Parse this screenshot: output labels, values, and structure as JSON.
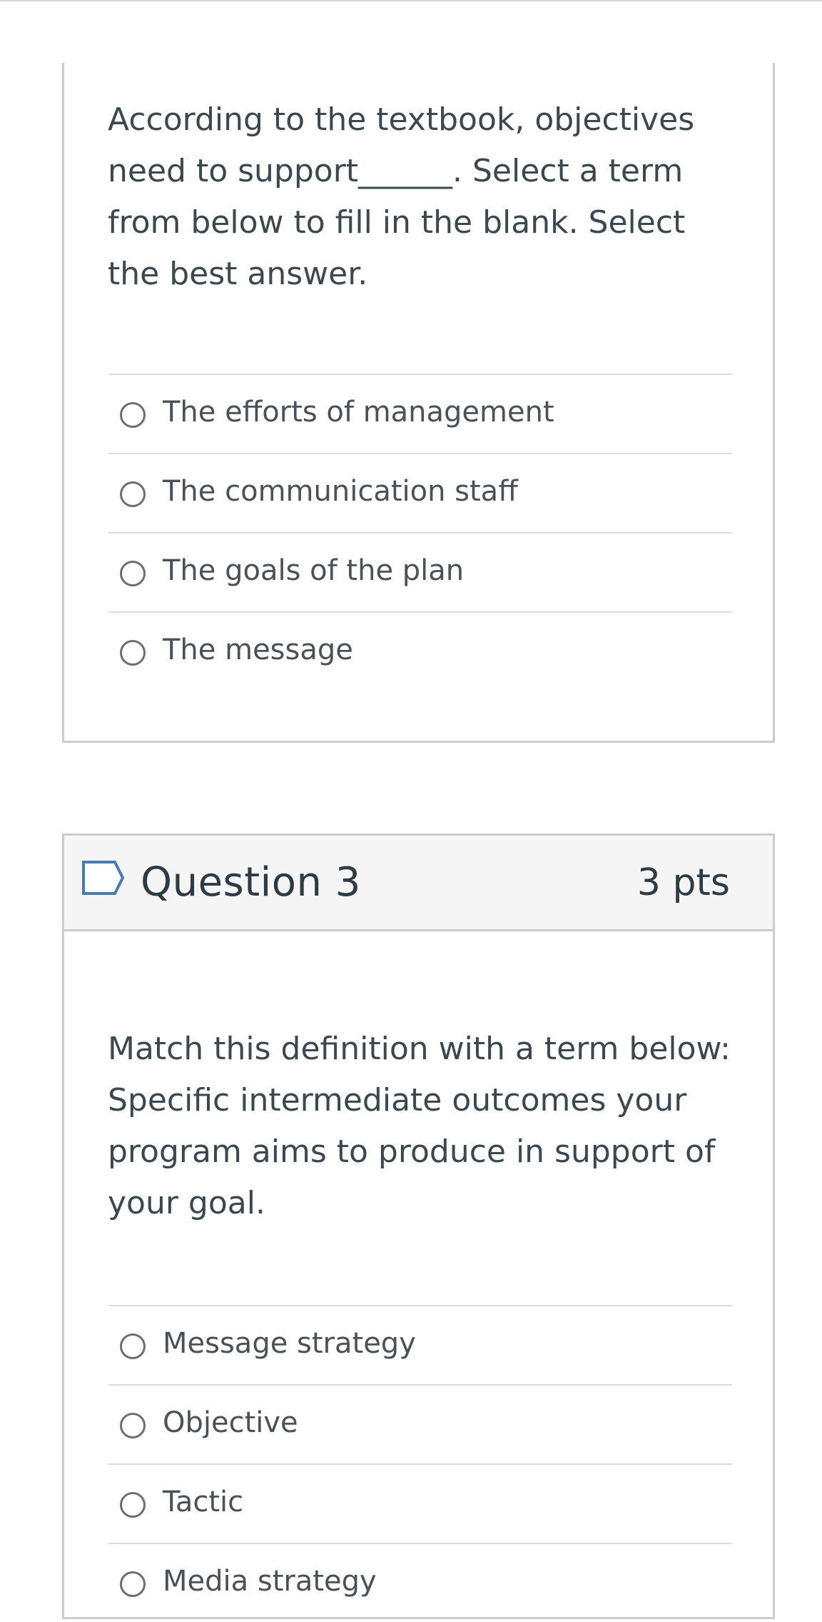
{
  "question2": {
    "text": "According to the textbook, objectives need to support______.  Select a term from below to fill in the blank.  Select the best answer.",
    "answers": [
      {
        "label": "The efforts of management"
      },
      {
        "label": "The communication staff"
      },
      {
        "label": "The goals of the plan"
      },
      {
        "label": "The message"
      }
    ]
  },
  "question3": {
    "title": "Question 3",
    "points": "3 pts",
    "flag_icon": "flag-outline-icon",
    "text": "Match this definition with a term below: Specific intermediate outcomes your program aims to produce in support of your goal.",
    "answers": [
      {
        "label": "Message strategy"
      },
      {
        "label": "Objective"
      },
      {
        "label": "Tactic"
      },
      {
        "label": "Media strategy"
      }
    ]
  },
  "colors": {
    "border": "#c7cdd1",
    "header_bg": "#f5f5f5",
    "flag_outline": "#4a7bb0",
    "text": "#2d3b45"
  }
}
